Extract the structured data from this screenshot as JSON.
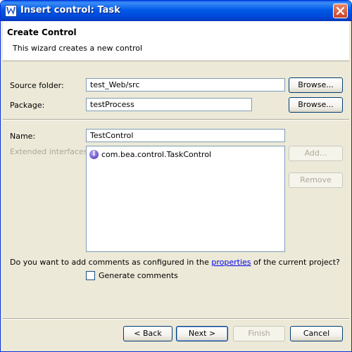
{
  "window": {
    "title": "Insert control: Task",
    "icons": {
      "app": "workshop-app-icon",
      "close": "close-icon"
    }
  },
  "header": {
    "title": "Create Control",
    "description": "This wizard creates a new control"
  },
  "form": {
    "source_folder": {
      "label": "Source folder:",
      "value": "test_Web/src",
      "browse_label": "Browse..."
    },
    "package": {
      "label": "Package:",
      "value": "testProcess",
      "browse_label": "Browse..."
    },
    "name": {
      "label": "Name:",
      "value": "TestControl"
    },
    "extended_interfaces": {
      "label": "Extended interfaces:",
      "items": [
        {
          "icon": "interface-icon",
          "icon_glyph": "I",
          "text": "com.bea.control.TaskControl"
        }
      ],
      "add_label": "Add...",
      "remove_label": "Remove"
    },
    "comments": {
      "question_prefix": "Do you want to add comments as configured in the ",
      "link_text": "properties",
      "question_suffix": " of the current project?",
      "checkbox_label": "Generate comments",
      "checked": false
    }
  },
  "footer": {
    "back_label": "< Back",
    "next_label": "Next >",
    "finish_label": "Finish",
    "cancel_label": "Cancel"
  },
  "colors": {
    "titlebar": "#0059e6",
    "dialog_bg": "#ece9d8",
    "border": "#7f9db9",
    "link": "#0000ee",
    "disabled_text": "#aca899"
  }
}
